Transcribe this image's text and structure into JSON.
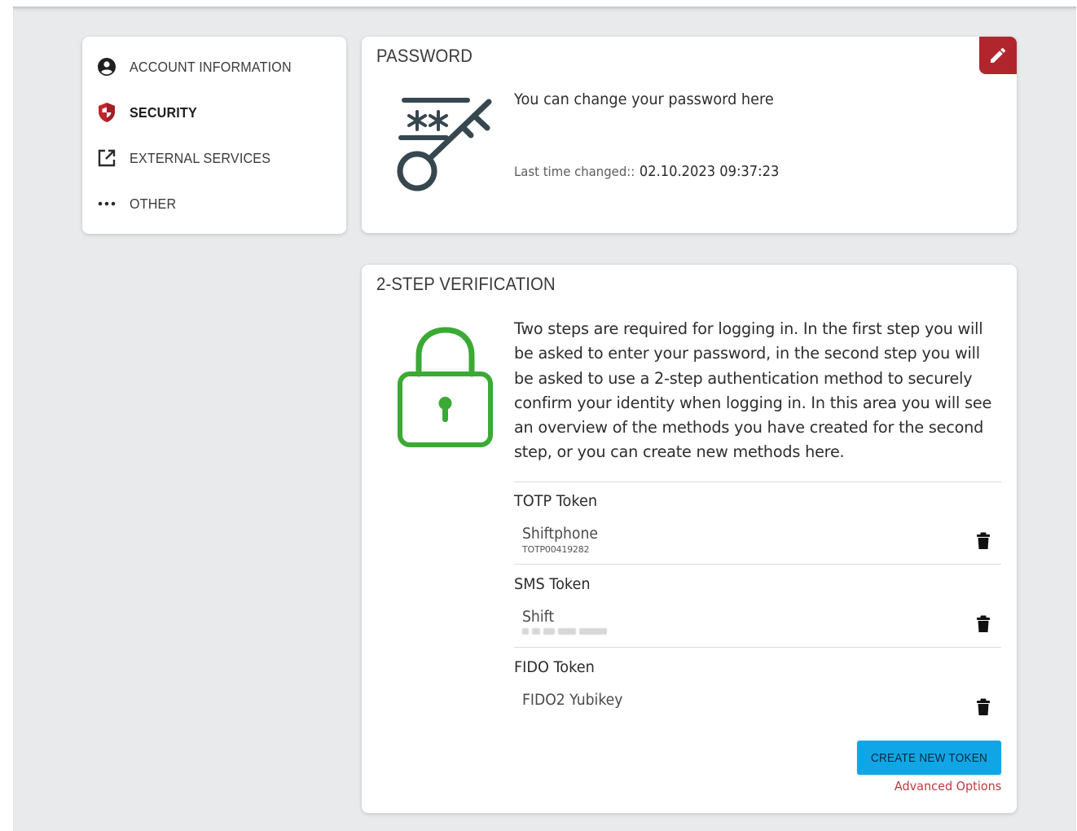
{
  "sidebar": {
    "items": [
      {
        "label": "ACCOUNT INFORMATION",
        "icon": "account-circle-icon",
        "active": false
      },
      {
        "label": "SECURITY",
        "icon": "shield-icon",
        "active": true
      },
      {
        "label": "EXTERNAL SERVICES",
        "icon": "external-link-icon",
        "active": false
      },
      {
        "label": "OTHER",
        "icon": "more-dots-icon",
        "active": false
      }
    ]
  },
  "password": {
    "title": "PASSWORD",
    "description": "You can change your password here",
    "last_changed_label": "Last time changed::",
    "last_changed_value": "02.10.2023 09:37:23",
    "edit_icon": "pencil-icon"
  },
  "two_step": {
    "title": "2-STEP VERIFICATION",
    "description": "Two steps are required for logging in. In the first step you will be asked to enter your password, in the second step you will be asked to use a 2-step authentication method to securely confirm your identity when logging in. In this area you will see an overview of the methods you have created for the second step, or you can create new methods here.",
    "groups": [
      {
        "title": "TOTP Token",
        "token_name": "Shiftphone",
        "token_id": "TOTP00419282"
      },
      {
        "title": "SMS Token",
        "token_name": "Shift",
        "token_id": ""
      },
      {
        "title": "FIDO Token",
        "token_name": "FIDO2 Yubikey",
        "token_id": ""
      }
    ],
    "create_button": "CREATE NEW TOKEN",
    "advanced_link": "Advanced Options"
  },
  "colors": {
    "accent_red": "#b0262c",
    "lock_green": "#3aaa35",
    "key_slate": "#37474f",
    "button_blue": "#10a6e6",
    "link_red": "#c0393f"
  }
}
